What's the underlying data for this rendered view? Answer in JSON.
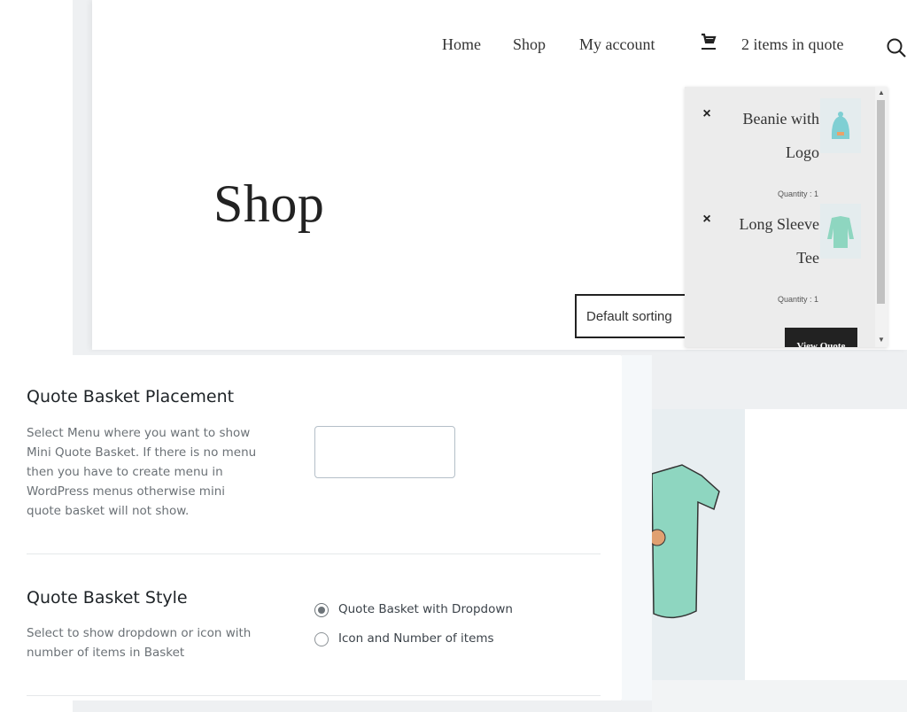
{
  "header": {
    "nav": [
      "Home",
      "Shop",
      "My account"
    ],
    "quote_count": "2 items in quote",
    "icons": {
      "cart": "cart-icon",
      "search": "search-icon"
    }
  },
  "page": {
    "title": "Shop",
    "sorting": "Default sorting"
  },
  "mini_quote": {
    "items": [
      {
        "name_line1": "Beanie with",
        "name_line2": "Logo",
        "quantity": "Quantity : 1",
        "remove": "×"
      },
      {
        "name_line1": "Long Sleeve",
        "name_line2": "Tee",
        "quantity": "Quantity : 1",
        "remove": "×"
      }
    ],
    "view_button": "View Quote"
  },
  "settings": {
    "placement": {
      "title": "Quote Basket Placement",
      "description": "Select Menu where you want to show Mini Quote Basket. If there is no menu then you have to create menu in WordPress menus otherwise mini quote basket will not show.",
      "select_value": ""
    },
    "style": {
      "title": "Quote Basket Style",
      "description": "Select to show dropdown or icon with number of items in Basket",
      "options": [
        {
          "label": "Quote Basket with Dropdown",
          "selected": true
        },
        {
          "label": "Icon and Number of items",
          "selected": false
        }
      ]
    }
  },
  "colors": {
    "dark": "#222222",
    "tshirt": "#8ed6c0",
    "beanie": "#7fcfd3"
  }
}
